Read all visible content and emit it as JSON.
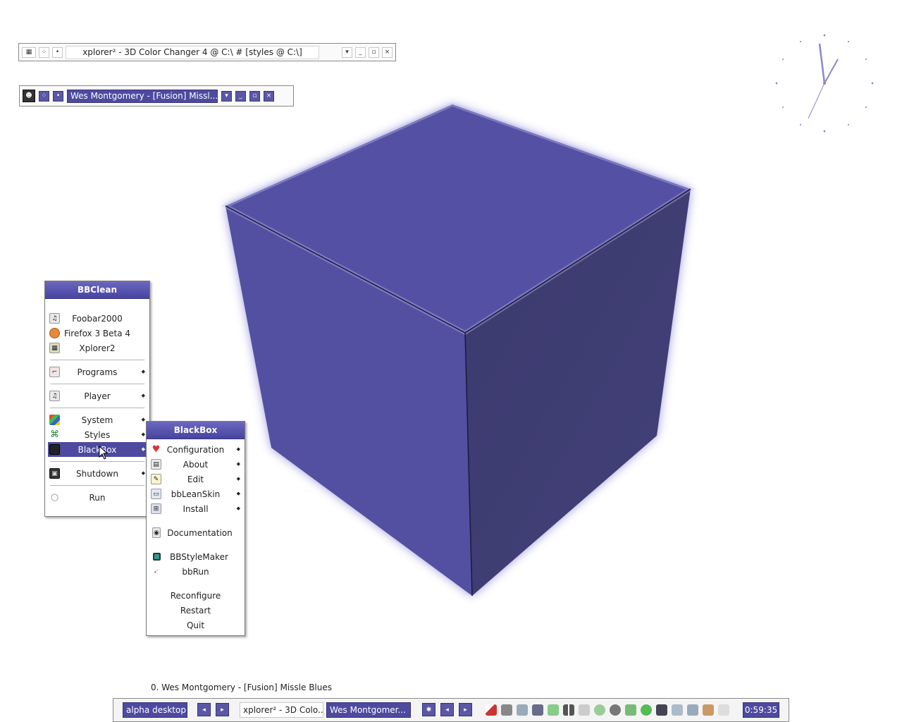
{
  "windows": [
    {
      "title": "xplorer² - 3D Color Changer 4 @ C:\\ # [styles @ C:\\]"
    },
    {
      "title": "Wes Montgomery - [Fusion] Missl..."
    }
  ],
  "window_buttons": {
    "menu": "▾",
    "minimize": "_",
    "maximize": "▫",
    "close": "×",
    "pin": "•",
    "sticky": "⁘"
  },
  "bbclean_menu": {
    "title": "BBClean",
    "items": [
      {
        "label": "Foobar2000",
        "icon": "foobar-icon"
      },
      {
        "label": "Firefox 3 Beta 4",
        "icon": "firefox-icon"
      },
      {
        "label": "Xplorer2",
        "icon": "xplorer-icon"
      },
      {
        "label": "Programs",
        "icon": "programs-icon",
        "submenu": true
      },
      {
        "label": "Player",
        "icon": "player-icon",
        "submenu": true
      },
      {
        "label": "System",
        "icon": "system-icon",
        "submenu": true
      },
      {
        "label": "Styles",
        "icon": "styles-icon",
        "submenu": true
      },
      {
        "label": "BlackBox",
        "icon": "blackbox-icon",
        "submenu": true,
        "active": true
      },
      {
        "label": "Shutdown",
        "icon": "shutdown-icon",
        "submenu": true
      },
      {
        "label": "Run",
        "icon": "run-icon"
      }
    ]
  },
  "blackbox_menu": {
    "title": "BlackBox",
    "items": [
      {
        "label": "Configuration",
        "icon": "configuration-icon",
        "submenu": true
      },
      {
        "label": "About",
        "icon": "about-icon",
        "submenu": true
      },
      {
        "label": "Edit",
        "icon": "edit-icon",
        "submenu": true
      },
      {
        "label": "bbLeanSkin",
        "icon": "bbleanskin-icon",
        "submenu": true
      },
      {
        "label": "Install",
        "icon": "install-icon",
        "submenu": true
      },
      {
        "label": "Documentation",
        "icon": "documentation-icon"
      },
      {
        "label": "BBStyleMaker",
        "icon": "bbstylemaker-icon"
      },
      {
        "label": "bbRun",
        "icon": "bbrun-icon"
      },
      {
        "label": "Reconfigure"
      },
      {
        "label": "Restart"
      },
      {
        "label": "Quit"
      }
    ]
  },
  "now_playing": "0. Wes Montgomery - [Fusion] Missle Blues",
  "taskbar": {
    "workspace": "alpha desktop",
    "tasks": [
      "xplorer² - 3D Colo...",
      "Wes Montgomer..."
    ],
    "clock": "0:59:35"
  },
  "colors": {
    "accent": "#4d4aa0",
    "cube_face": "#5552a3",
    "cube_dark": "#3e3c75"
  }
}
